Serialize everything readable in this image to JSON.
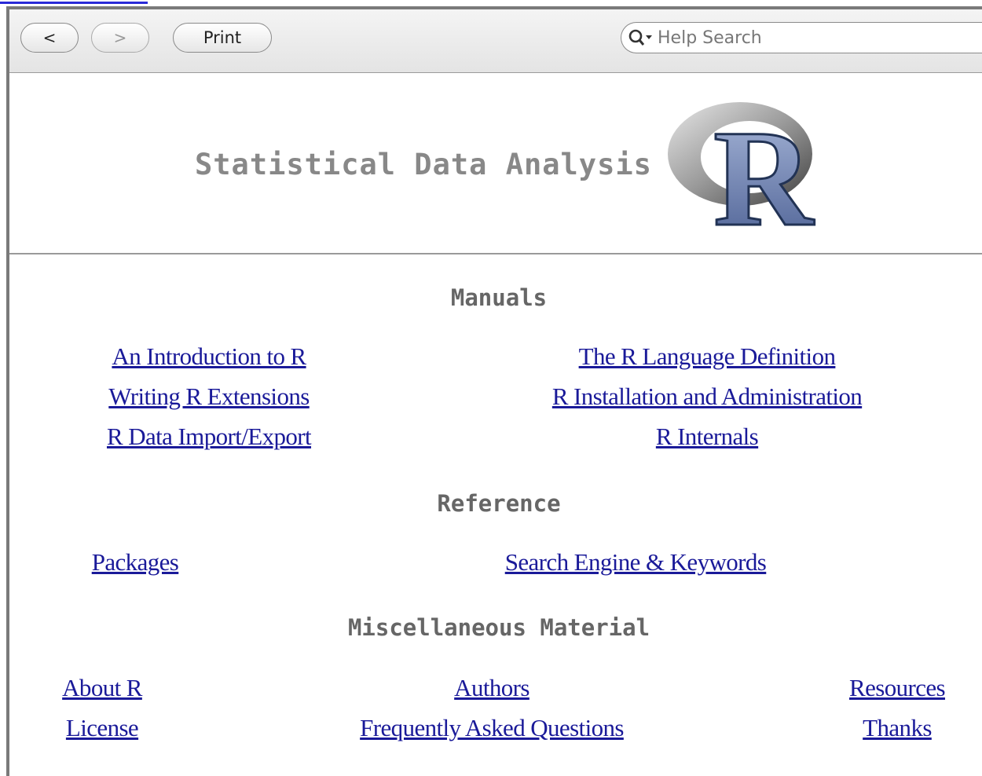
{
  "toolbar": {
    "back_label": "<",
    "forward_label": ">",
    "print_label": "Print",
    "search_placeholder": "Help Search"
  },
  "banner": {
    "title": "Statistical Data Analysis",
    "logo_letter": "R"
  },
  "sections": {
    "manuals": {
      "heading": "Manuals",
      "links": [
        "An Introduction to R",
        "Writing R Extensions",
        "R Data Import/Export",
        "The R Language Definition",
        "R Installation and Administration",
        "R Internals"
      ]
    },
    "reference": {
      "heading": "Reference",
      "links": [
        "Packages",
        "Search Engine & Keywords"
      ]
    },
    "misc": {
      "heading": "Miscellaneous Material",
      "links": [
        "About R",
        "License",
        "Authors",
        "Frequently Asked Questions",
        "Resources",
        "Thanks"
      ]
    }
  },
  "colors": {
    "link": "#1a1a99",
    "heading": "#666666",
    "banner_title": "#888888"
  },
  "icons": [
    "search-icon",
    "r-logo"
  ]
}
